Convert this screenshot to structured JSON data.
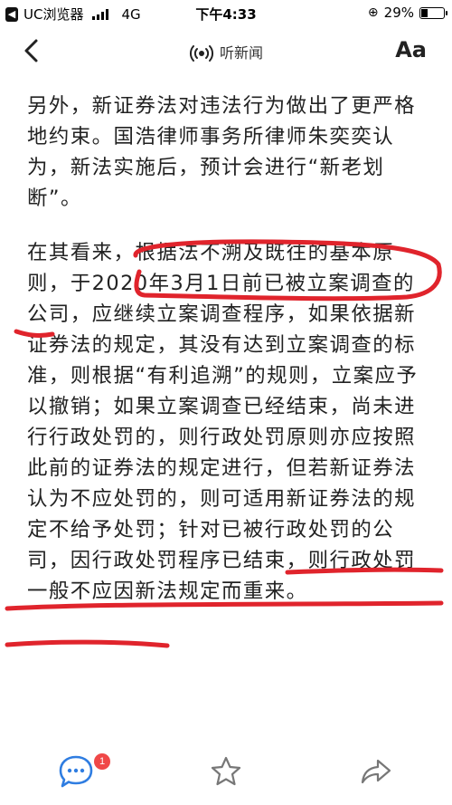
{
  "status_bar": {
    "app_name": "UC浏览器",
    "network": "4G",
    "time": "下午4:33",
    "battery_text": "29%",
    "battery_level": 0.29
  },
  "nav": {
    "back_icon": "chevron-left-icon",
    "title": "听新闻",
    "title_icon": "radio-broadcast-icon",
    "font_size_label": "Aa"
  },
  "article": {
    "paragraphs": [
      "另外，新证券法对违法行为做出了更严格地约束。国浩律师事务所律师朱奕奕认为，新法实施后，预计会进行“新老划断”。",
      "在其看来，根据法不溯及既往的基本原则，于2020年3月1日前已被立案调查的公司，应继续立案调查程序，如果依据新证券法的规定，其没有达到立案调查的标准，则根据“有利追溯”的规则，立案应予以撤销；如果立案调查已经结束，尚未进行行政处罚的，则行政处罚原则亦应按照此前的证券法的规定进行，但若新证券法认为不应处罚的，则可适用新证券法的规定不给予处罚；针对已被行政处罚的公司，因行政处罚程序已结束，则行政处罚一般不应因新法规定而重来。"
    ]
  },
  "annotations": {
    "color": "#e0242c"
  },
  "bottom_bar": {
    "comment_icon": "comment-bubble-icon",
    "comment_count": "1",
    "favorite_icon": "star-icon",
    "share_icon": "share-arrow-icon",
    "accent_color": "#2f7de1",
    "badge_color": "#f04848"
  }
}
